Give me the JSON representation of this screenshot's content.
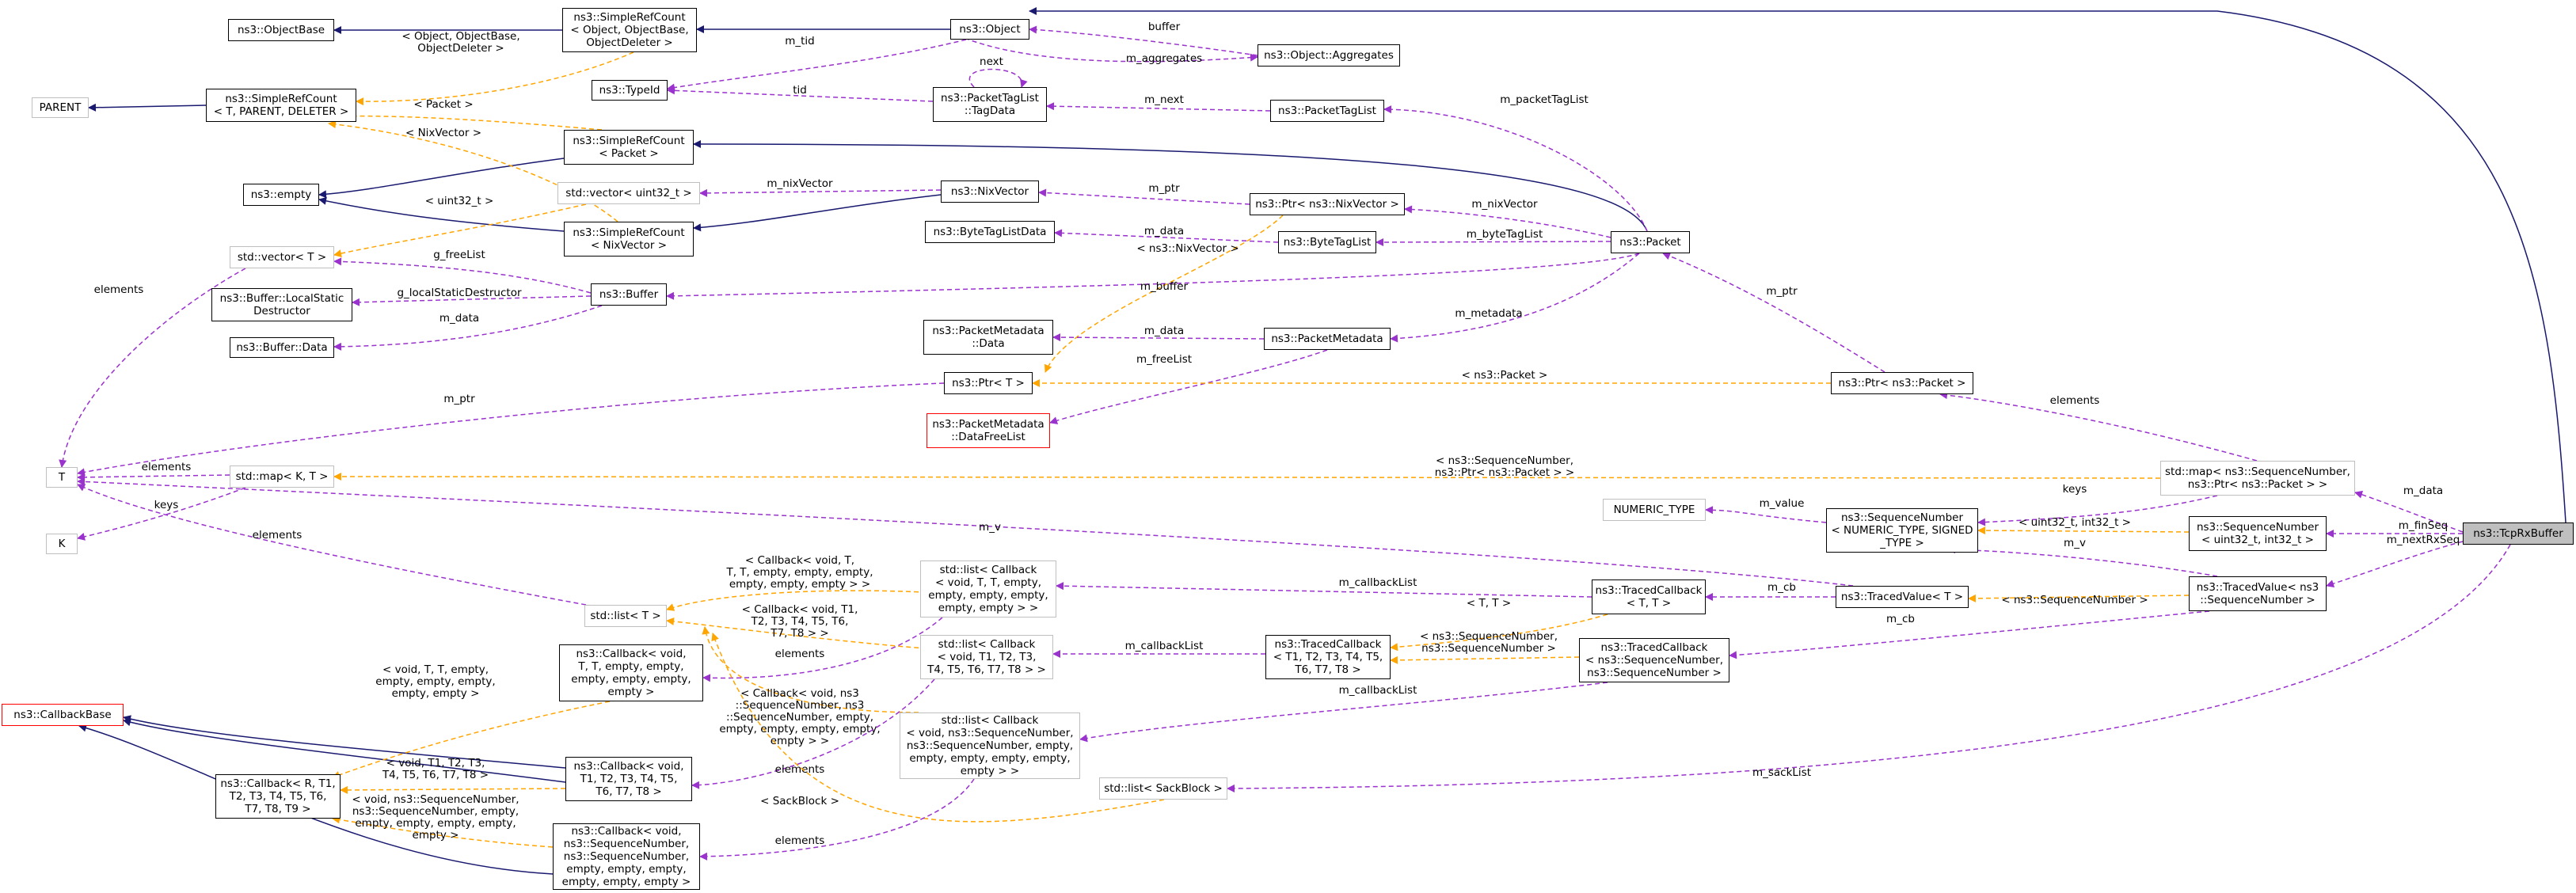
{
  "nodes": {
    "objectbase": "ns3::ObjectBase",
    "parent": "PARENT",
    "srcount_tpd": "ns3::SimpleRefCount\n< T, PARENT, DELETER >",
    "empty": "ns3::empty",
    "vector_t": "std::vector< T >",
    "buffer_lsd": "ns3::Buffer::LocalStatic\nDestructor",
    "buffer_data": "ns3::Buffer::Data",
    "T": "T",
    "K": "K",
    "map_kt": "std::map< K, T >",
    "list_t": "std::list< T >",
    "callbackbase": "ns3::CallbackBase",
    "cb_generic": "ns3::Callback< R, T1,\nT2, T3, T4, T5, T6,\nT7, T8, T9 >",
    "cb_void_t": "ns3::Callback< void,\nT, T, empty, empty,\nempty, empty, empty,\nempty >",
    "cb_void_t1": "ns3::Callback< void,\nT1, T2, T3, T4, T5,\nT6, T7, T8 >",
    "cb_void_seq": "ns3::Callback< void,\nns3::SequenceNumber,\nns3::SequenceNumber,\nempty, empty, empty,\nempty, empty, empty >",
    "srcount_oboo": "ns3::SimpleRefCount\n< Object, ObjectBase,\nObjectDeleter >",
    "typeid": "ns3::TypeId",
    "srcount_packet": "ns3::SimpleRefCount\n< Packet >",
    "vector_u32": "std::vector< uint32_t >",
    "srcount_nix": "ns3::SimpleRefCount\n< NixVector >",
    "buffer": "ns3::Buffer",
    "object": "ns3::Object",
    "ptlist_tagdata": "ns3::PacketTagList\n::TagData",
    "nixvector": "ns3::NixVector",
    "btl_data": "ns3::ByteTagListData",
    "pm_data": "ns3::PacketMetadata\n::Data",
    "ptr_t": "ns3::Ptr< T >",
    "pm_dfl": "ns3::PacketMetadata\n::DataFreeList",
    "list_cb_t": "std::list< Callback\n< void, T, T, empty,\nempty, empty, empty,\nempty, empty > >",
    "list_cb_t1": "std::list< Callback\n< void, T1, T2, T3,\nT4, T5, T6, T7, T8 > >",
    "list_cb_seq": "std::list< Callback\n< void, ns3::SequenceNumber,\nns3::SequenceNumber, empty,\nempty, empty, empty, empty,\nempty > >",
    "obj_aggregates": "ns3::Object::Aggregates",
    "packettaglist": "ns3::PacketTagList",
    "ptr_nix": "ns3::Ptr< ns3::NixVector >",
    "bytetaglist": "ns3::ByteTagList",
    "packetmetadata": "ns3::PacketMetadata",
    "tracedcb_t1": "ns3::TracedCallback\n< T1, T2, T3, T4, T5,\nT6, T7, T8 >",
    "list_sackblock": "std::list< SackBlock >",
    "numeric_type": "NUMERIC_TYPE",
    "tracedcb_tt": "ns3::TracedCallback\n< T, T >",
    "tracedcb_seq": "ns3::TracedCallback\n< ns3::SequenceNumber,\nns3::SequenceNumber >",
    "packet": "ns3::Packet",
    "ptr_packet": "ns3::Ptr< ns3::Packet >",
    "seqnum_generic": "ns3::SequenceNumber\n< NUMERIC_TYPE, SIGNED\n_TYPE >",
    "tracedvalue_t": "ns3::TracedValue< T >",
    "map_seq_ptr": "std::map< ns3::SequenceNumber,\nns3::Ptr< ns3::Packet > >",
    "seqnum_u32": "ns3::SequenceNumber\n< uint32_t, int32_t >",
    "tracedvalue_seq": "ns3::TracedValue< ns3\n::SequenceNumber >",
    "tcprxbuffer": "ns3::TcpRxBuffer"
  },
  "edge_labels": {
    "srcount_oboo_objectbase": "< Object, ObjectBase,\nObjectDeleter >",
    "m_tid": "m_tid",
    "buffer": "buffer",
    "m_aggregates": "m_aggregates",
    "next": "next",
    "tid": "tid",
    "m_next": "m_next",
    "m_packetTagList": "m_packetTagList",
    "tpl_packet": "< Packet >",
    "tpl_nixvector": "< NixVector >",
    "m_nixVector_vec": "m_nixVector",
    "m_ptr_nix": "m_ptr",
    "m_nixVector": "m_nixVector",
    "tpl_uint32": "< uint32_t >",
    "m_data_btl": "m_data",
    "m_byteTagList": "m_byteTagList",
    "tpl_ptr_nix": "< ns3::NixVector >",
    "g_freeList": "g_freeList",
    "g_localStaticDestructor": "g_localStaticDestructor",
    "m_data_buf": "m_data",
    "m_buffer": "m_buffer",
    "elements_vec": "elements",
    "m_data_pm": "m_data",
    "m_metadata": "m_metadata",
    "m_freeList": "m_freeList",
    "m_ptr_pkt": "m_ptr",
    "m_ptr_t": "m_ptr",
    "tpl_ptr_pkt": "< ns3::Packet >",
    "elements_map": "elements",
    "elements_mapkt": "elements",
    "keys_mapkt": "keys",
    "tpl_map_seq": "< ns3::SequenceNumber,\nns3::Ptr< ns3::Packet > >",
    "keys_map": "keys",
    "m_data_rx": "m_data",
    "m_value": "m_value",
    "tpl_u32_i32": "< uint32_t, int32_t >",
    "m_finSeq": "m_finSeq",
    "m_v_tv": "m_v",
    "m_v_long": "m_v",
    "m_nextRxSeq": "m_nextRxSeq",
    "elements_list": "elements",
    "m_callbackList_tt": "m_callbackList",
    "m_cb_tt": "m_cb",
    "tpl_tt": "< T, T >",
    "tpl_seq": "< ns3::SequenceNumber >",
    "tpl_cb_void_t": "< Callback< void, T,\nT, T, empty, empty, empty,\nempty, empty, empty > >",
    "tpl_cb_void_t1": "< Callback< void, T1,\nT2, T3, T4, T5, T6,\nT7, T8 > >",
    "elements_cbt": "elements",
    "m_callbackList_t1": "m_callbackList",
    "tpl_seq_seq": "< ns3::SequenceNumber,\nns3::SequenceNumber >",
    "m_cb_seq": "m_cb",
    "tpl_cb_seq_list": "< Callback< void, ns3\n::SequenceNumber, ns3\n::SequenceNumber, empty,\nempty, empty, empty, empty,\nempty > >",
    "elements_cbt1": "elements",
    "m_callbackList_seq": "m_callbackList",
    "tpl_void_tt": "< void, T, T, empty,\nempty, empty, empty,\nempty, empty >",
    "tpl_void_t1": "< void, T1, T2, T3,\nT4, T5, T6, T7, T8 >",
    "tpl_void_seq": "< void, ns3::SequenceNumber,\nns3::SequenceNumber, empty,\nempty, empty, empty, empty,\nempty >",
    "tpl_sackblock": "< SackBlock >",
    "elements_seq": "elements",
    "m_sackList": "m_sackList"
  },
  "colors": {
    "inheritance": "#191970",
    "usage": "#9a32cd",
    "template": "#ffa500",
    "node_border": "#000000",
    "undocumented_border": "#bfbfbf",
    "incomplete_border": "#ff0000",
    "selected_fill": "#bfbfbf"
  }
}
